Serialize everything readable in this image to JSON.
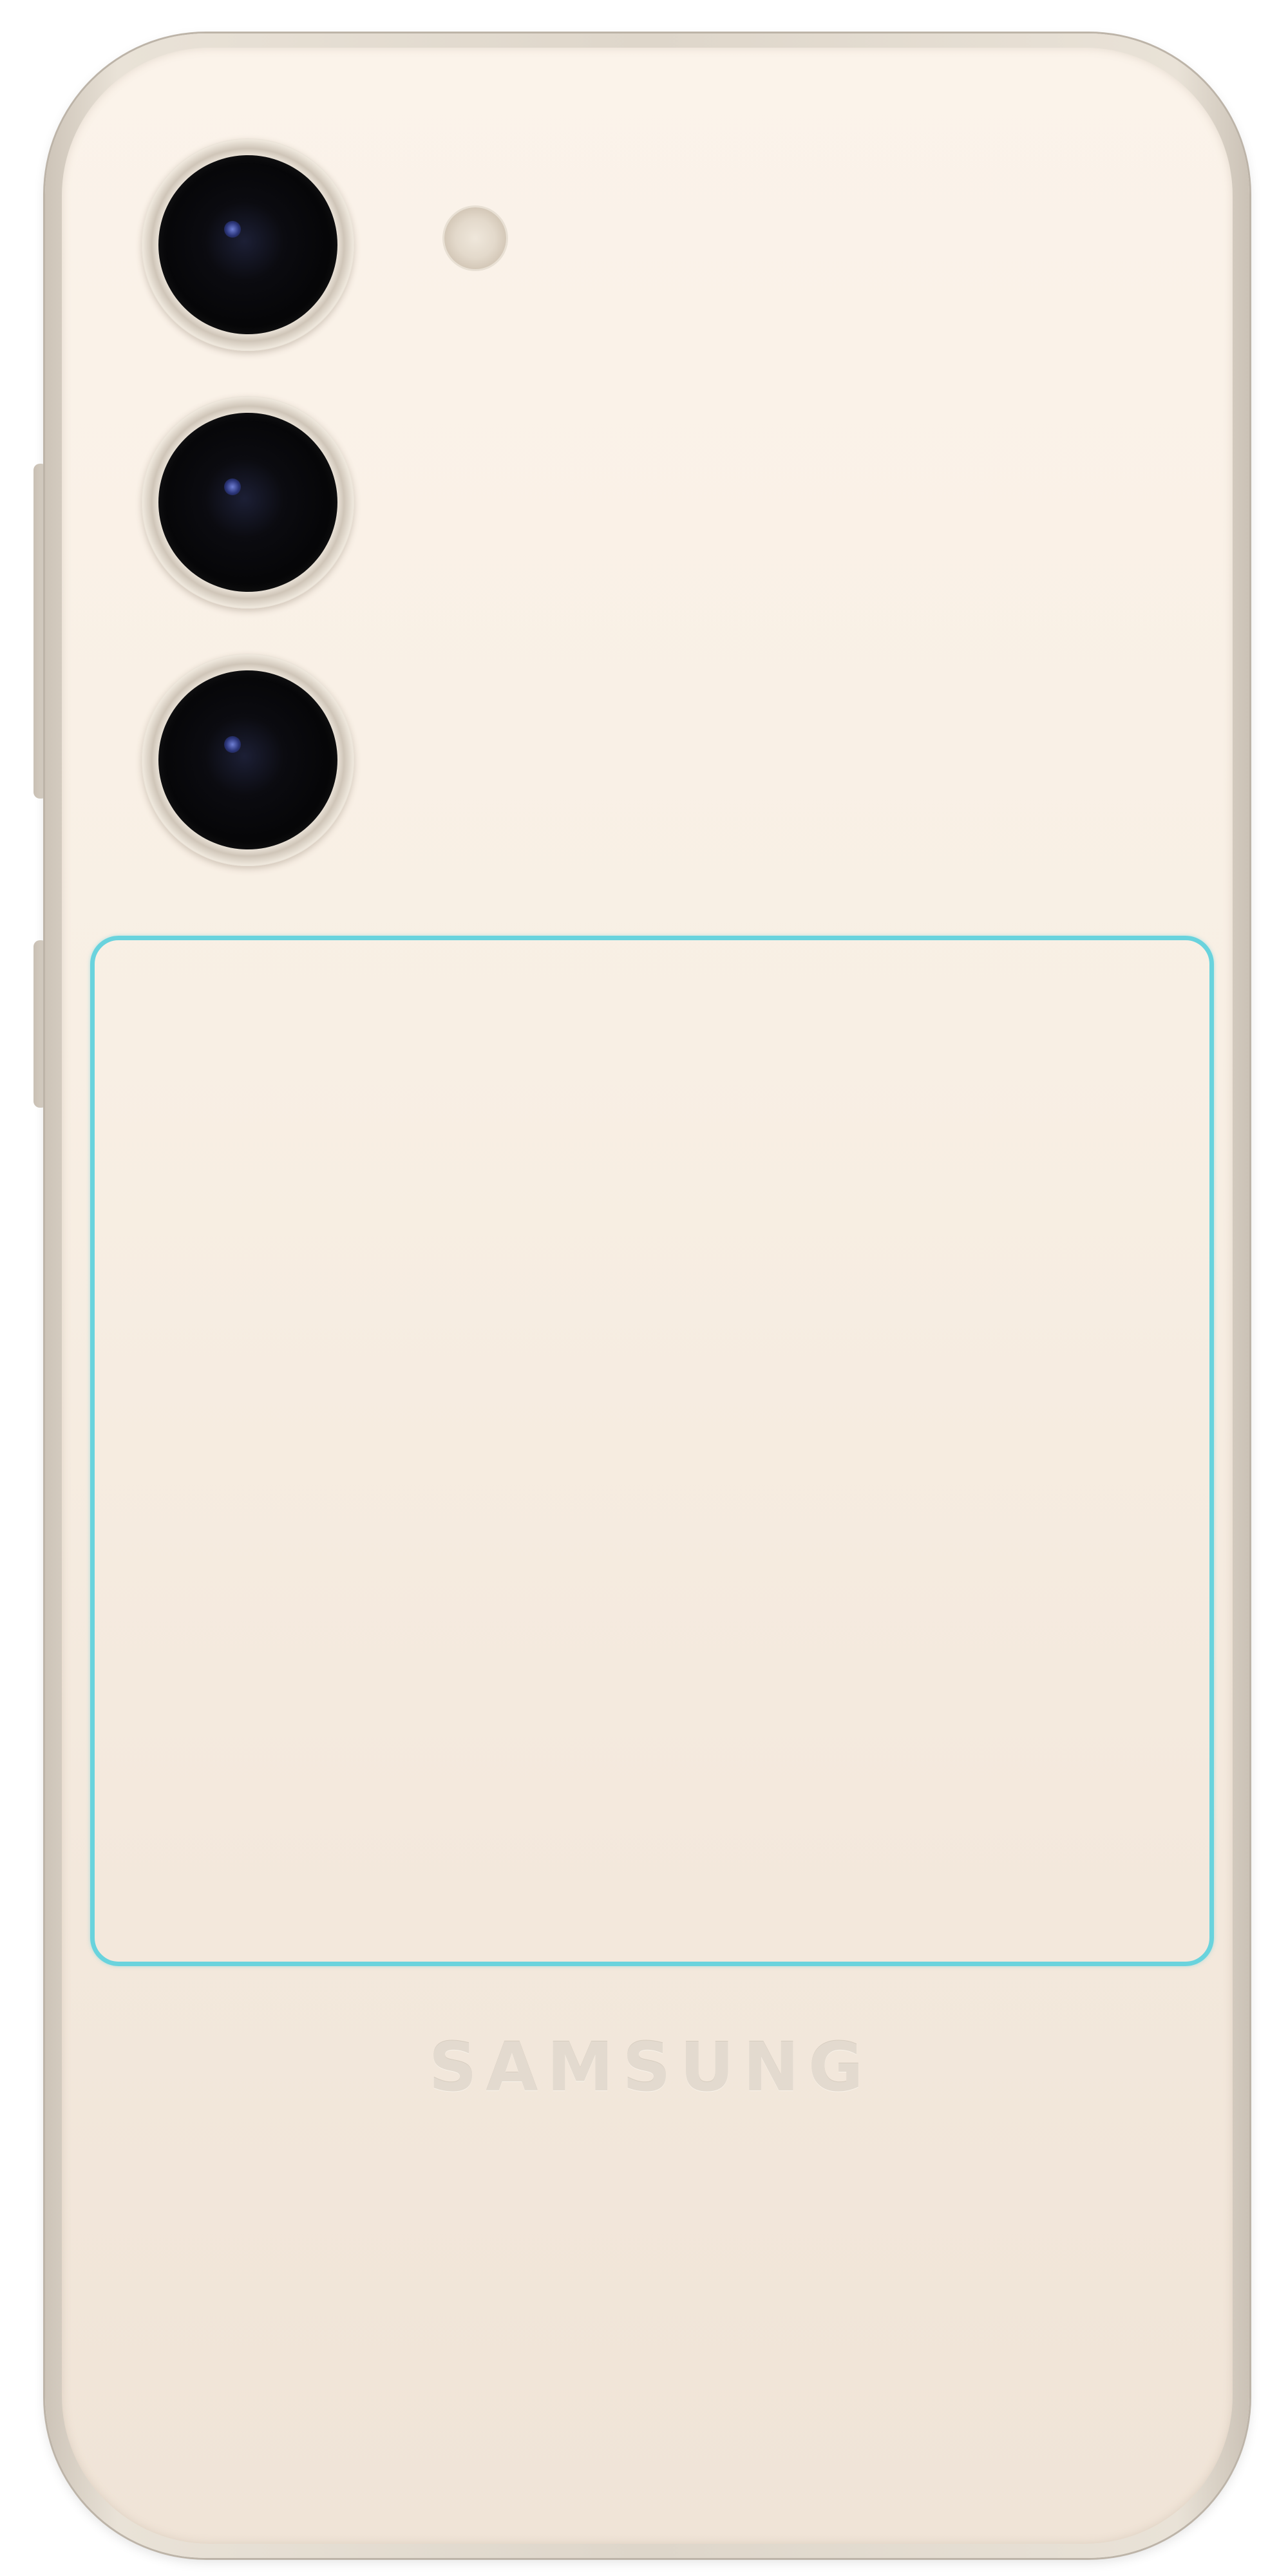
{
  "brand": {
    "logo_text": "SAMSUNG"
  },
  "phone": {
    "finish_color": "#f8efe4",
    "frame_color": "#ded6ca",
    "camera_count": 3
  },
  "highlight": {
    "outline_color": "#69d3dd"
  },
  "icons": {
    "lenses": [
      "camera-lens-icon",
      "camera-lens-icon",
      "camera-lens-icon"
    ],
    "flash": "flash-icon"
  }
}
